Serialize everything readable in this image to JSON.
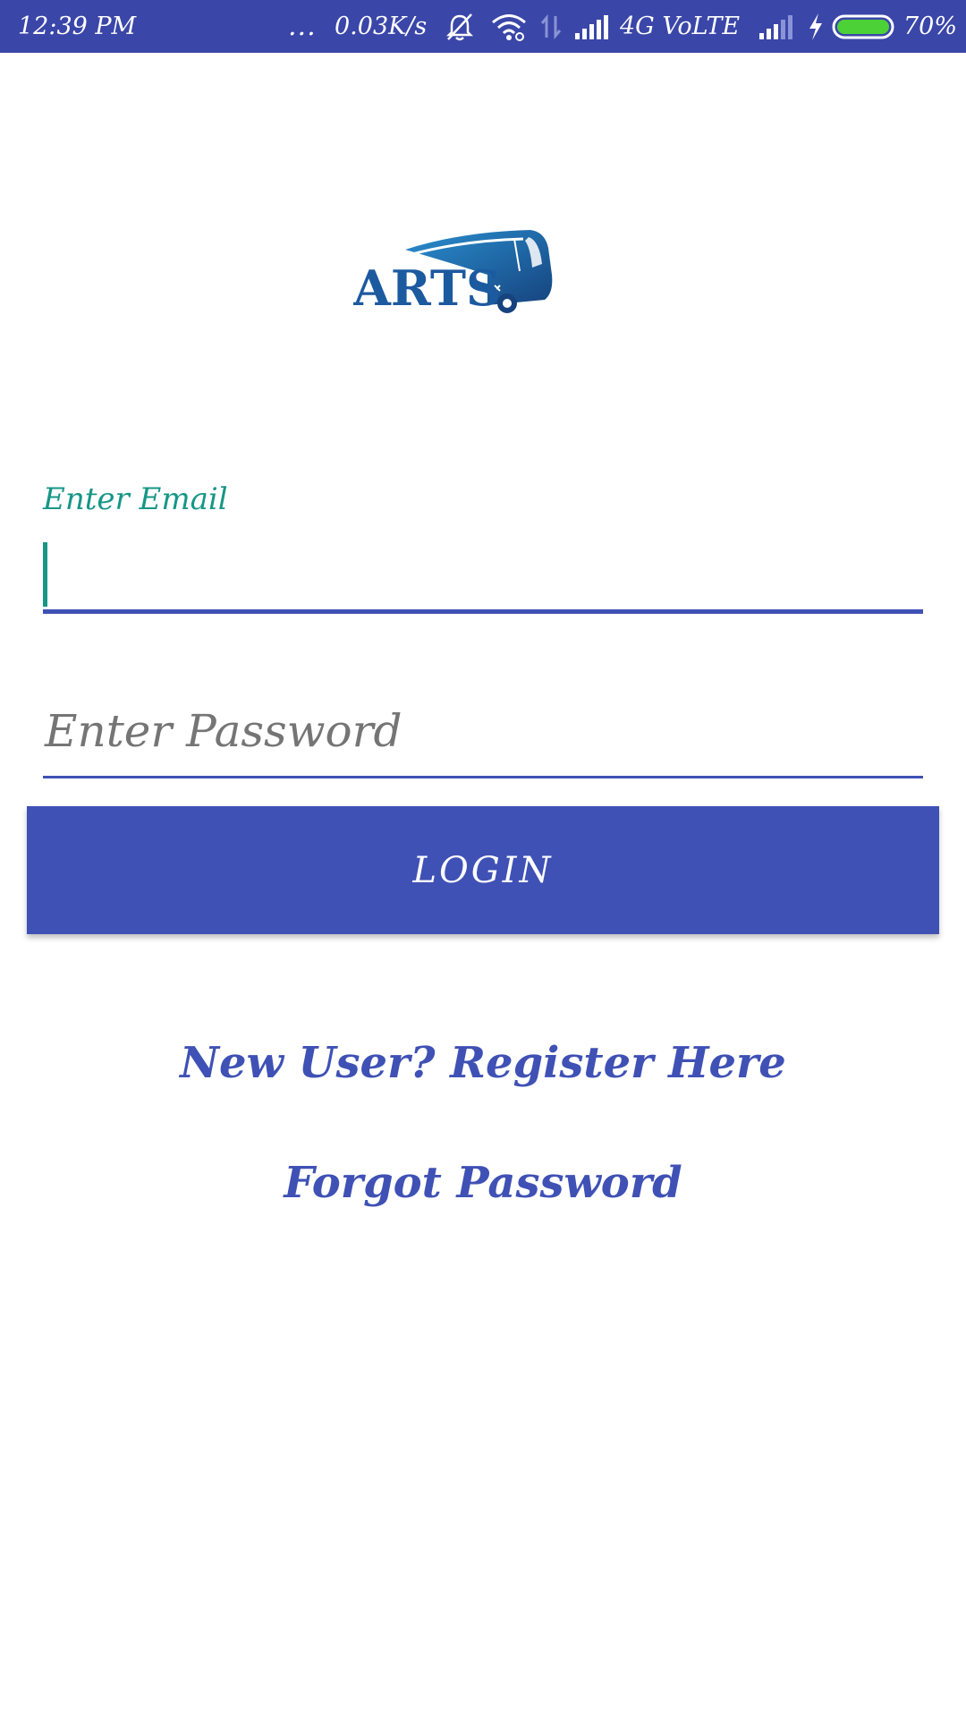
{
  "status_bar": {
    "time": "12:39 PM",
    "dots": "...",
    "net_speed": "0.03K/s",
    "network_label": "4G VoLTE",
    "battery_percent": "70%",
    "battery_level": 0.7,
    "icons": [
      "mute-icon",
      "wifi-icon",
      "data-arrows-icon",
      "signal-icon",
      "signal-icon",
      "charging-icon",
      "battery-icon"
    ]
  },
  "logo": {
    "text": "ARTS"
  },
  "form": {
    "email_label": "Enter Email",
    "email_value": "",
    "password_placeholder": "Enter Password",
    "password_value": "",
    "login_label": "LOGIN"
  },
  "links": {
    "register": "New User? Register Here",
    "forgot": "Forgot Password"
  },
  "colors": {
    "status_bar": "#3a46a8",
    "primary": "#3f51b5",
    "accent": "#169686",
    "placeholder": "#757575",
    "battery_fill": "#4cd137"
  }
}
